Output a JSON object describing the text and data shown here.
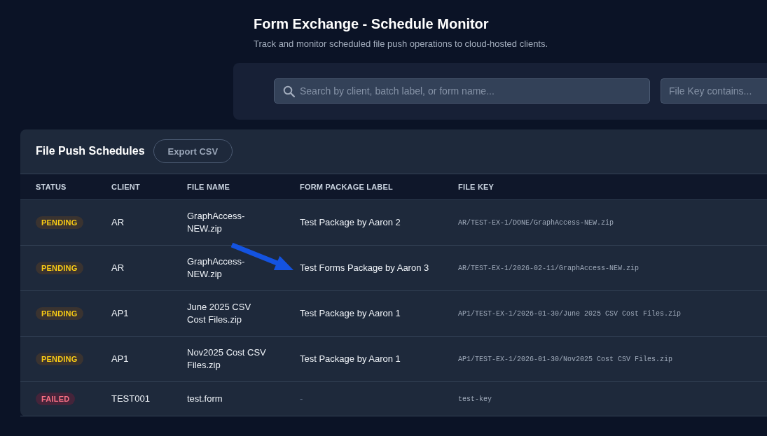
{
  "header": {
    "title": "Form Exchange - Schedule Monitor",
    "subtitle": "Track and monitor scheduled file push operations to cloud-hosted clients."
  },
  "filters": {
    "search": {
      "placeholder": "Search by client, batch label, or form name..."
    },
    "file_key": {
      "placeholder": "File Key contains..."
    }
  },
  "table": {
    "title": "File Push Schedules",
    "export_button": "Export CSV",
    "columns": [
      "STATUS",
      "CLIENT",
      "FILE NAME",
      "FORM PACKAGE LABEL",
      "FILE KEY"
    ],
    "rows": [
      {
        "status": {
          "label": "PENDING",
          "kind": "pending"
        },
        "client": "AR",
        "file_name": "GraphAccess-NEW.zip",
        "form_package_label": "Test Package by Aaron 2",
        "label_muted": false,
        "file_key": "AR/TEST-EX-1/DONE/GraphAccess-NEW.zip",
        "marked": false
      },
      {
        "status": {
          "label": "PENDING",
          "kind": "pending"
        },
        "client": "AR",
        "file_name": "GraphAccess-NEW.zip",
        "form_package_label": "Test Forms Package by Aaron 3",
        "label_muted": false,
        "file_key": "AR/TEST-EX-1/2026-02-11/GraphAccess-NEW.zip",
        "marked": true
      },
      {
        "status": {
          "label": "PENDING",
          "kind": "pending"
        },
        "client": "AP1",
        "file_name": "June 2025 CSV Cost Files.zip",
        "form_package_label": "Test Package by Aaron 1",
        "label_muted": false,
        "file_key": "AP1/TEST-EX-1/2026-01-30/June 2025 CSV Cost Files.zip",
        "marked": false
      },
      {
        "status": {
          "label": "PENDING",
          "kind": "pending"
        },
        "client": "AP1",
        "file_name": "Nov2025 Cost CSV Files.zip",
        "form_package_label": "Test Package by Aaron 1",
        "label_muted": false,
        "file_key": "AP1/TEST-EX-1/2026-01-30/Nov2025 Cost CSV Files.zip",
        "marked": false
      },
      {
        "status": {
          "label": "FAILED",
          "kind": "failed"
        },
        "client": "TEST001",
        "file_name": "test.form",
        "form_package_label": "-",
        "label_muted": true,
        "file_key": "test-key",
        "marked": false
      }
    ]
  }
}
